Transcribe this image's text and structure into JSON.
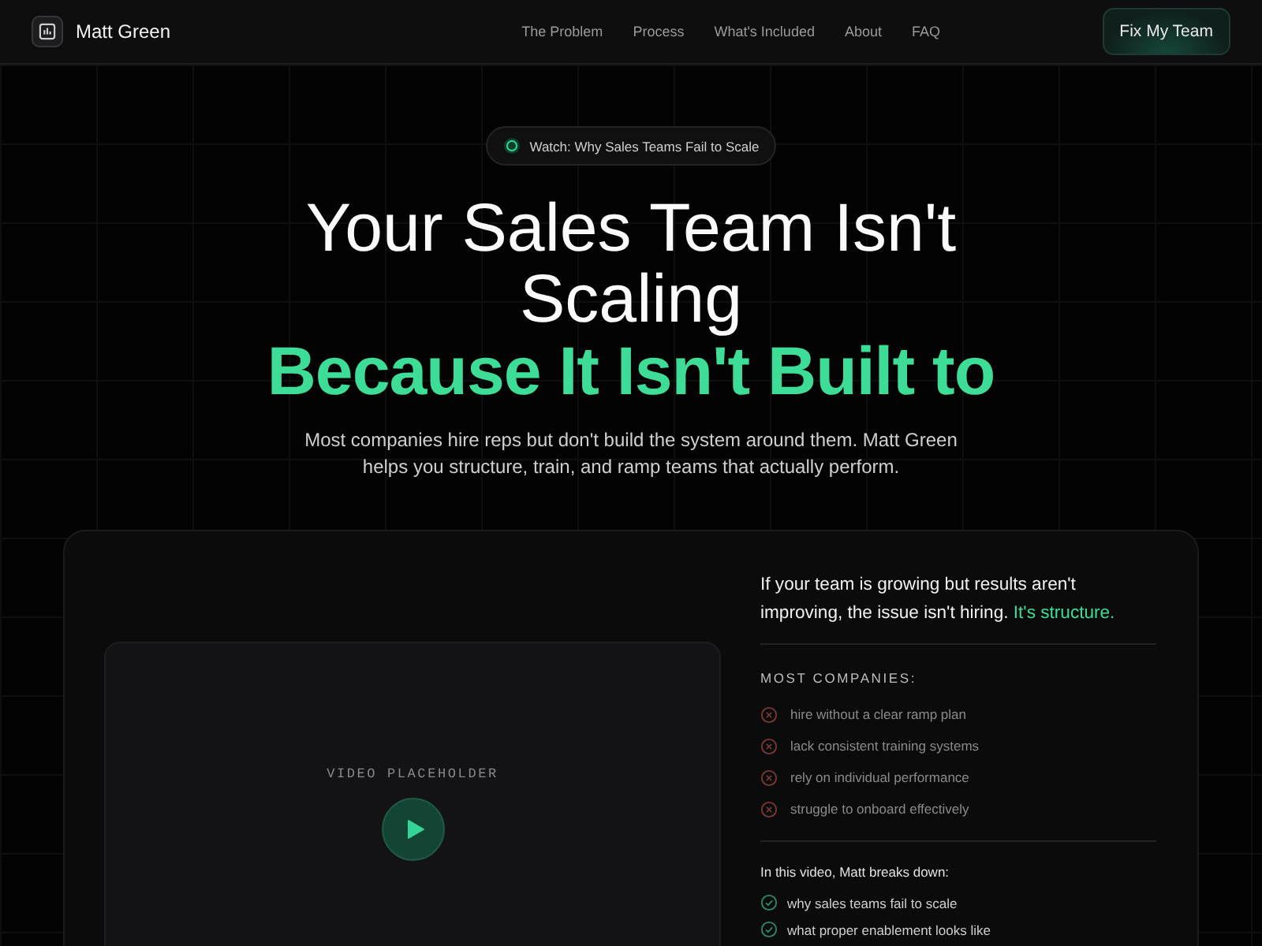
{
  "brand": {
    "name": "Matt Green"
  },
  "nav": [
    "The Problem",
    "Process",
    "What's Included",
    "About",
    "FAQ"
  ],
  "cta": "Fix My Team",
  "badge": "Watch: Why Sales Teams Fail to Scale",
  "headline": {
    "title": "Your Sales Team Isn't Scaling",
    "accent": "Because It Isn't Built to"
  },
  "subtitle": "Most companies hire reps but don't build the system around them. Matt Green helps you structure, train, and ramp teams that actually perform.",
  "video": {
    "label": "VIDEO PLACEHOLDER"
  },
  "intro": {
    "text": "If your team is growing but results aren't improving, the issue isn't hiring.",
    "accent": "It's structure."
  },
  "problems": {
    "heading": "MOST COMPANIES:",
    "items": [
      {
        "kind": "bad",
        "text": "hire without a clear ramp plan"
      },
      {
        "kind": "bad",
        "text": "lack consistent training systems"
      },
      {
        "kind": "bad",
        "text": "rely on individual performance"
      },
      {
        "kind": "bad",
        "text": "struggle to onboard effectively"
      }
    ]
  },
  "breakdown": {
    "heading": "In this video, Matt breaks down:",
    "items": [
      {
        "kind": "good",
        "text": "why sales teams fail to scale"
      },
      {
        "kind": "good",
        "text": "what proper enablement looks like"
      }
    ]
  }
}
